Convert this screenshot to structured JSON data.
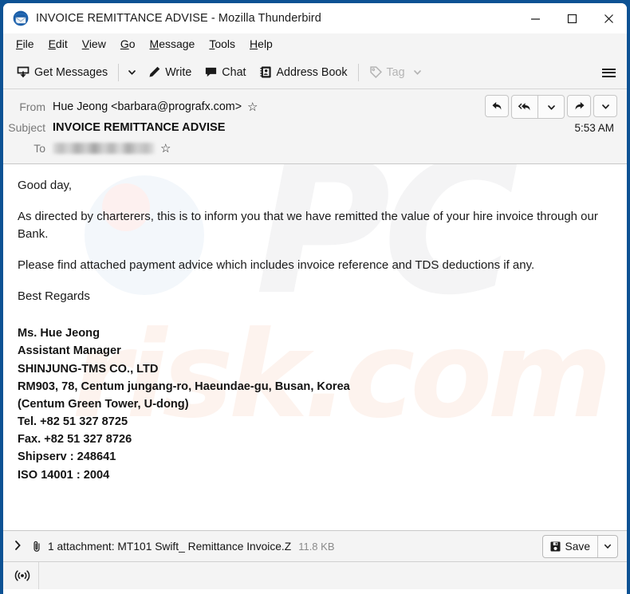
{
  "window": {
    "title": "INVOICE REMITTANCE ADVISE - Mozilla Thunderbird",
    "app_icon": "thunderbird-icon",
    "controls": {
      "minimize": "minimize-icon",
      "maximize": "maximize-icon",
      "close": "close-icon"
    },
    "border_color": "#0d5294"
  },
  "menubar": {
    "items": [
      {
        "label": "File",
        "accesskey": "F"
      },
      {
        "label": "Edit",
        "accesskey": "E"
      },
      {
        "label": "View",
        "accesskey": "V"
      },
      {
        "label": "Go",
        "accesskey": "G"
      },
      {
        "label": "Message",
        "accesskey": "M"
      },
      {
        "label": "Tools",
        "accesskey": "T"
      },
      {
        "label": "Help",
        "accesskey": "H"
      }
    ]
  },
  "toolbar": {
    "get_messages_label": "Get Messages",
    "get_messages_icon": "download-inbox-icon",
    "get_messages_caret": "chevron-down-icon",
    "write_label": "Write",
    "write_icon": "pencil-icon",
    "chat_label": "Chat",
    "chat_icon": "speech-bubble-icon",
    "address_book_label": "Address Book",
    "address_book_icon": "address-book-icon",
    "tag_label": "Tag",
    "tag_icon": "tag-icon",
    "tag_caret": "chevron-down-icon",
    "tag_disabled": true,
    "app_menu_icon": "hamburger-menu-icon"
  },
  "message": {
    "from_label": "From",
    "from_value": "Hue Jeong <barbara@prografx.com>",
    "from_star": "star-icon",
    "subject_label": "Subject",
    "subject_value": "INVOICE REMITTANCE ADVISE",
    "to_label": "To",
    "to_value": "",
    "to_redacted": true,
    "to_star": "star-icon",
    "time": "5:53 AM",
    "actions": {
      "reply": "reply-icon",
      "reply_all": "reply-all-icon",
      "reply_caret": "chevron-down-icon",
      "forward": "forward-icon",
      "more_caret": "chevron-down-icon"
    }
  },
  "body": {
    "watermark_pc": "PC",
    "watermark_risk": "risk.com",
    "paragraphs": [
      "Good day,",
      "As directed by charterers, this is to inform you that we have remitted the value of your hire invoice through our Bank.",
      "Please find attached payment advice which includes invoice reference and TDS deductions if any.",
      "Best  Regards"
    ],
    "signature": [
      "Ms. Hue Jeong",
      "Assistant Manager",
      "SHINJUNG-TMS CO., LTD",
      "RM903, 78, Centum jungang-ro, Haeundae-gu, Busan, Korea",
      "(Centum Green Tower, U-dong)",
      "Tel. +82 51 327 8725",
      "Fax. +82 51 327 8726",
      "Shipserv : 248641",
      "ISO 14001 : 2004"
    ]
  },
  "attachment": {
    "twisty_icon": "chevron-right-icon",
    "paperclip_icon": "paperclip-icon",
    "text": "1 attachment: MT101 Swift_ Remittance Invoice.Z",
    "size": "11.8 KB",
    "save_label": "Save",
    "save_icon": "floppy-disk-icon",
    "save_caret": "chevron-down-icon"
  },
  "statusbar": {
    "connection_icon": "broadcast-signal-icon"
  }
}
